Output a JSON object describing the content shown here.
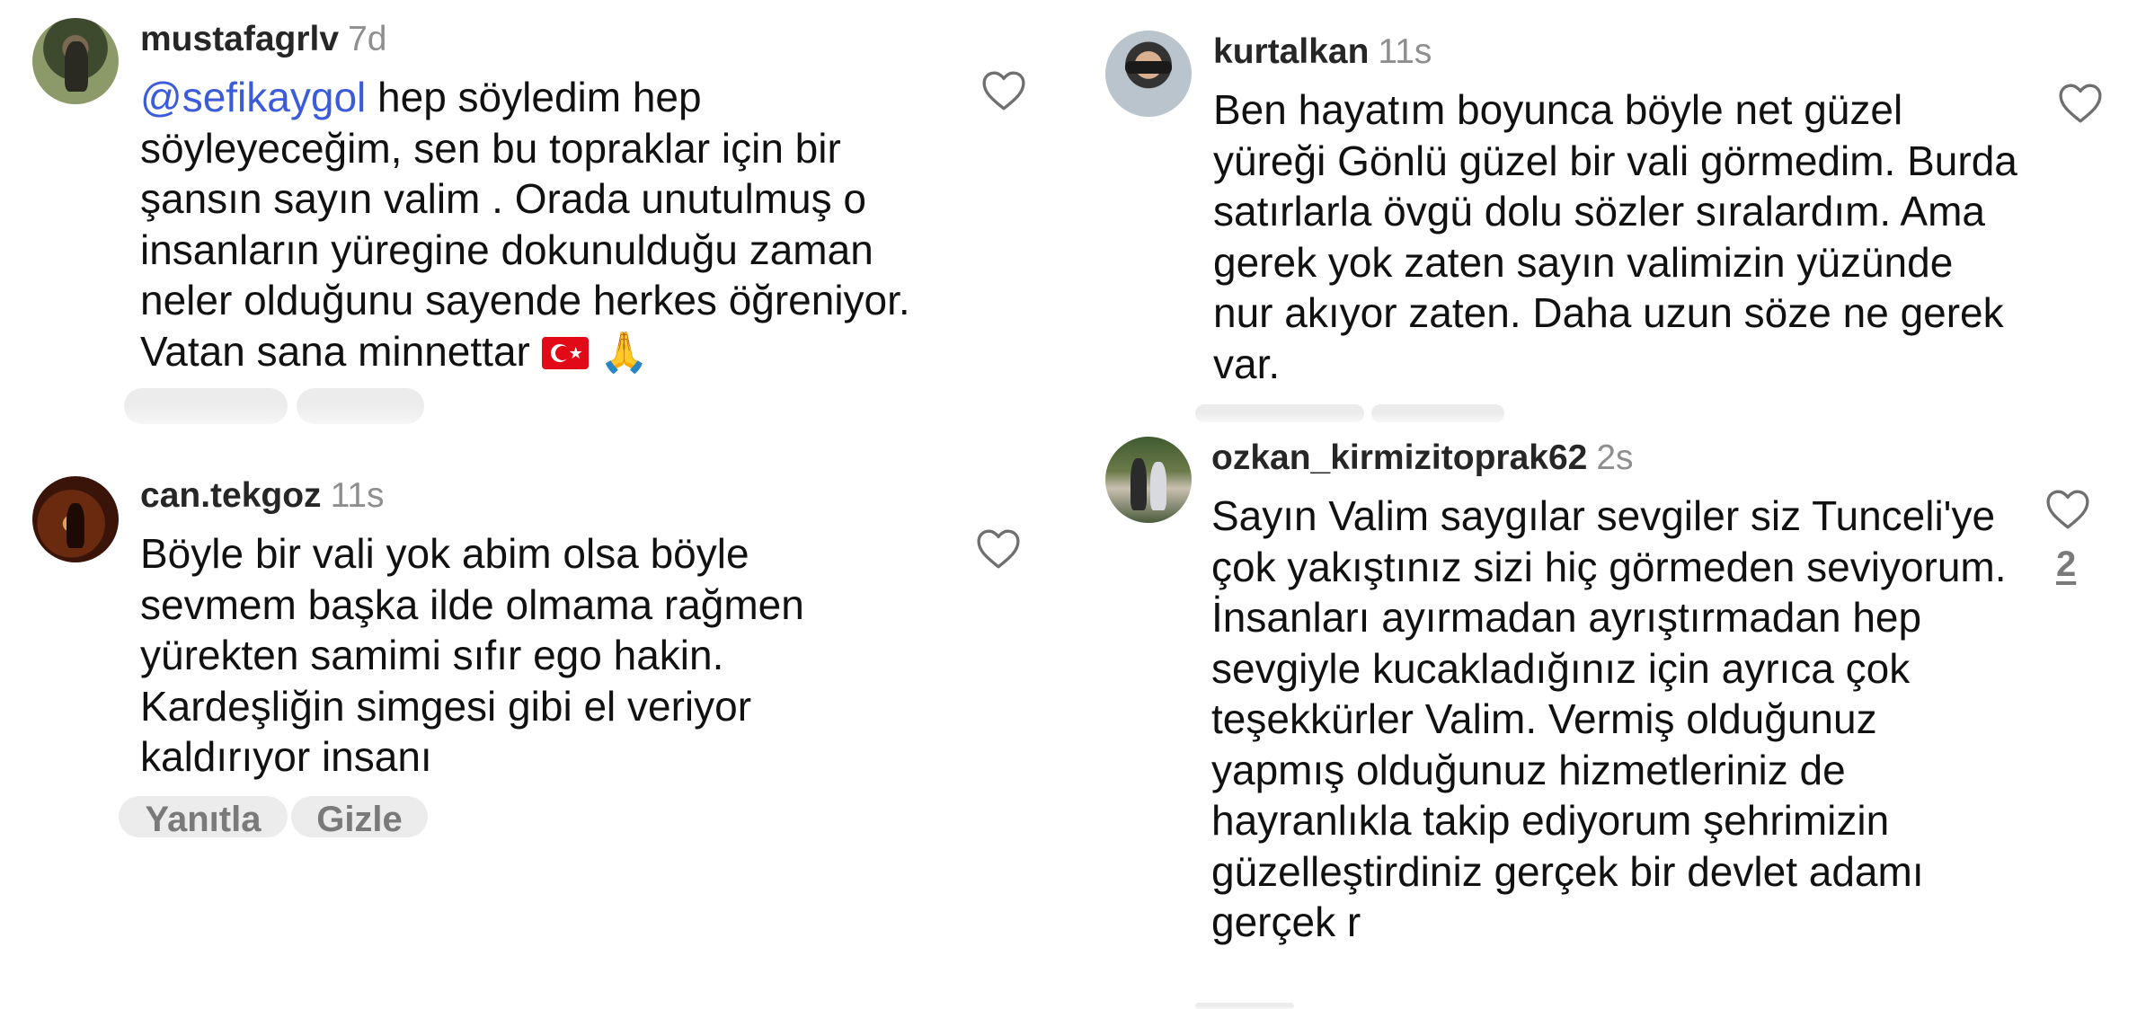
{
  "comments": [
    {
      "username": "mustafagrlv",
      "time": "7d",
      "mention": "@sefikaygol",
      "text": " hep söyledim hep söyleyeceğim,  sen bu topraklar için bir şansın sayın valim . Orada unutulmuş o insanların yüregine dokunulduğu zaman neler olduğunu sayende herkes öğreniyor. Vatan sana minnettar",
      "emoji": [
        "turkey-flag",
        "folded-hands"
      ],
      "emoji_text": "🙏"
    },
    {
      "username": "can.tekgoz",
      "time": "11s",
      "text": "Böyle bir vali yok abim olsa böyle sevmem başka ilde olmama rağmen yürekten samimi sıfır ego hakin. Kardeşliğin simgesi gibi el veriyor kaldırıyor insanı",
      "actions": {
        "reply": "Yanıtla",
        "hide": "Gizle"
      }
    },
    {
      "username": "kurtalkan",
      "time": "11s",
      "text": "Ben hayatım boyunca böyle net güzel yüreği Gönlü güzel bir vali görmedim. Burda satırlarla övgü dolu sözler sıralardım. Ama gerek yok zaten sayın valimizin yüzünde nur akıyor zaten. Daha uzun söze ne gerek var."
    },
    {
      "username": "ozkan_kirmizitoprak62",
      "time": "2s",
      "text": "Sayın Valim saygılar sevgiler siz Tunceli'ye çok yakıştınız  sizi hiç görmeden seviyorum.  İnsanları ayırmadan ayrıştırmadan hep sevgiyle kucakladığınız için ayrıca çok teşekkürler Valim.  Vermiş olduğunuz yapmış olduğunuz hizmetleriniz de hayranlıkla takip ediyorum şehrimizin güzelleştirdiniz  gerçek bir devlet adamı gerçek r",
      "like_count": "2"
    }
  ],
  "colors": {
    "mention": "#3b5bdb",
    "meta_gray": "#8e8e8e",
    "pill_bg": "#ececec"
  },
  "icons": {
    "like": "heart-outline-icon",
    "avatar": "profile-photo"
  }
}
